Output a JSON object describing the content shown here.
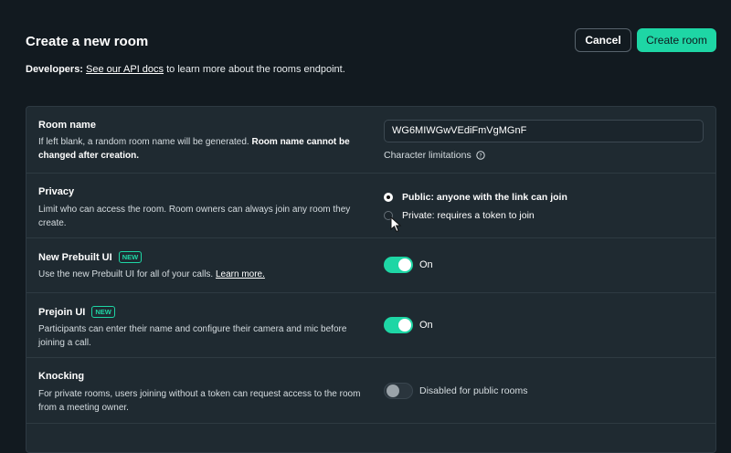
{
  "header": {
    "title": "Create a new room",
    "cancel_label": "Cancel",
    "create_label": "Create room"
  },
  "developers": {
    "label": "Developers:",
    "link": "See our API docs",
    "rest": "to learn more about the rooms endpoint."
  },
  "room_name": {
    "title": "Room name",
    "desc_plain": "If left blank, a random room name will be generated.",
    "desc_bold": "Room name cannot be changed after creation.",
    "value": "WG6MIWGwVEdiFmVgMGnF",
    "hint": "Character limitations"
  },
  "privacy": {
    "title": "Privacy",
    "desc": "Limit who can access the room. Room owners can always join any room they create.",
    "options": [
      {
        "label": "Public: anyone with the link can join",
        "selected": true
      },
      {
        "label": "Private: requires a token to join",
        "selected": false
      }
    ]
  },
  "prebuilt": {
    "title": "New Prebuilt UI",
    "badge": "NEW",
    "desc": "Use the new Prebuilt UI for all of your calls.",
    "link": "Learn more.",
    "state_label": "On",
    "enabled": true
  },
  "prejoin": {
    "title": "Prejoin UI",
    "badge": "NEW",
    "desc": "Participants can enter their name and configure their camera and mic before joining a call.",
    "state_label": "On",
    "enabled": true
  },
  "knocking": {
    "title": "Knocking",
    "desc": "For private rooms, users joining without a token can request access to the room from a meeting owner.",
    "state_label": "Disabled for public rooms",
    "enabled": false
  },
  "colors": {
    "accent": "#1ed6a5",
    "background": "#121a20",
    "panel": "#1f2a31"
  }
}
